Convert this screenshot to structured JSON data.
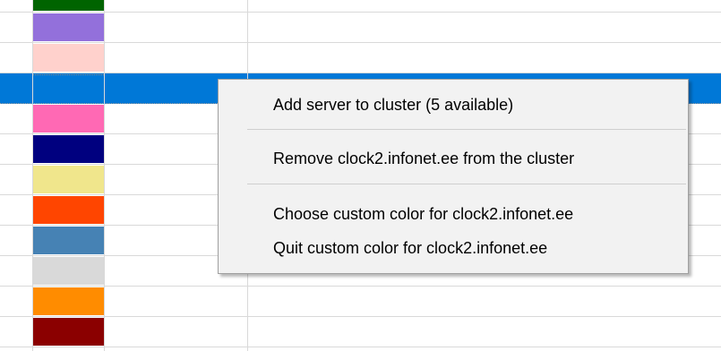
{
  "swatches": [
    {
      "color": "#006400"
    },
    {
      "color": "#9370db"
    },
    {
      "color": "#ffd1cc"
    },
    {
      "color": "#0078d7",
      "selected": true
    },
    {
      "color": "#ff69b4"
    },
    {
      "color": "#00007f"
    },
    {
      "color": "#f0e68c"
    },
    {
      "color": "#ff4500"
    },
    {
      "color": "#4682b4"
    },
    {
      "color": "#d9d9d9"
    },
    {
      "color": "#ff8c00"
    },
    {
      "color": "#8b0000"
    }
  ],
  "context_menu": {
    "items": [
      {
        "label": "Add server to cluster (5 available)"
      },
      {
        "label": "Remove clock2.infonet.ee from the cluster"
      },
      {
        "label": "Choose custom color for clock2.infonet.ee"
      },
      {
        "label": "Quit custom color for clock2.infonet.ee"
      }
    ]
  },
  "colors": {
    "selection": "#0078d7",
    "menu_background": "#f2f2f2",
    "grid_line": "#d9d9d9"
  }
}
